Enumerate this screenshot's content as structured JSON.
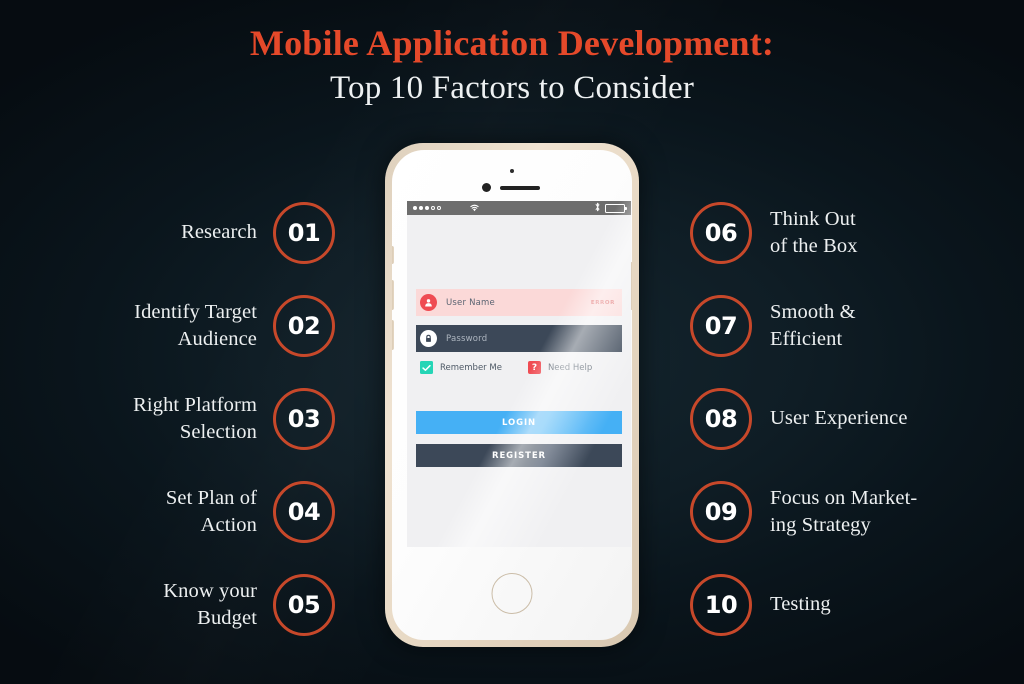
{
  "header": {
    "title_main": "Mobile Application Development:",
    "title_sub": "Top 10 Factors to Consider",
    "title_color": "#e5492a",
    "subtitle_color": "#eef1f2"
  },
  "theme": {
    "accent": "#c7482a",
    "background": "#0a151c",
    "text": "#edf0f1",
    "phone_bezel": "#e7d8c3",
    "screen_bg": "#f0f0f2"
  },
  "factors": {
    "left": [
      {
        "number": "01",
        "label": "Research"
      },
      {
        "number": "02",
        "label": "Identify Target\nAudience"
      },
      {
        "number": "03",
        "label": "Right Platform\nSelection"
      },
      {
        "number": "04",
        "label": "Set Plan of\nAction"
      },
      {
        "number": "05",
        "label": "Know your\nBudget"
      }
    ],
    "right": [
      {
        "number": "06",
        "label": "Think Out\nof the Box"
      },
      {
        "number": "07",
        "label": "Smooth &\nEfficient"
      },
      {
        "number": "08",
        "label": "User Experience"
      },
      {
        "number": "09",
        "label": "Focus on Market-\ning Strategy"
      },
      {
        "number": "10",
        "label": "Testing"
      }
    ]
  },
  "phone": {
    "status_bar": {
      "signal_filled": 3,
      "signal_total": 5,
      "wifi": "wifi-icon",
      "bluetooth": "bluetooth-icon",
      "battery": "battery-icon",
      "battery_level": 100
    },
    "login_form": {
      "username": {
        "placeholder": "User Name",
        "value": "",
        "icon": "user-icon",
        "state": "error",
        "error_label": "ERROR",
        "field_bg": "#fbd9d8",
        "icon_bg": "#ef4b52"
      },
      "password": {
        "placeholder": "Password",
        "value": "",
        "icon": "lock-icon",
        "field_bg": "#3c4858",
        "icon_bg": "#ffffff"
      },
      "remember_me": {
        "label": "Remember Me",
        "checked": true,
        "check_color": "#25d5b6"
      },
      "need_help": {
        "label": "Need Help",
        "badge_glyph": "?",
        "badge_color": "#ef4b52"
      },
      "login_button": {
        "label": "LOGIN",
        "color": "#45b0f5"
      },
      "register_button": {
        "label": "REGISTER",
        "color": "#3c4858"
      }
    }
  }
}
